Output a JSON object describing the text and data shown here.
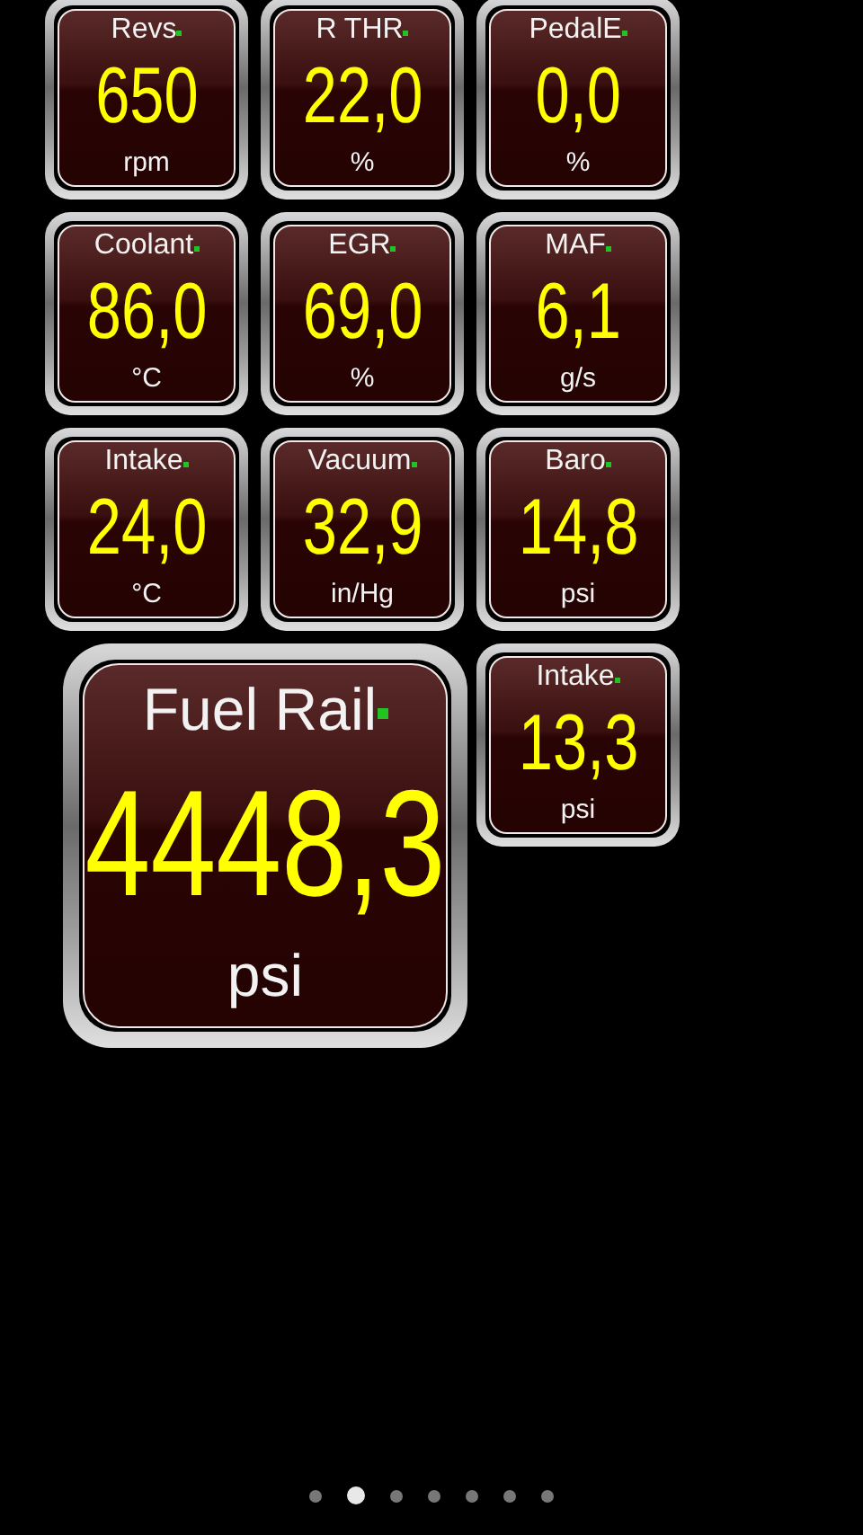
{
  "gauges": [
    {
      "label": "Revs",
      "value": "650",
      "unit": "rpm"
    },
    {
      "label": "R THR",
      "value": "22,0",
      "unit": "%"
    },
    {
      "label": "PedalE",
      "value": "0,0",
      "unit": "%"
    },
    {
      "label": "Coolant",
      "value": "86,0",
      "unit": "°C"
    },
    {
      "label": "EGR",
      "value": "69,0",
      "unit": "%"
    },
    {
      "label": "MAF",
      "value": "6,1",
      "unit": "g/s"
    },
    {
      "label": "Intake",
      "value": "24,0",
      "unit": "°C"
    },
    {
      "label": "Vacuum",
      "value": "32,9",
      "unit": "in/Hg"
    },
    {
      "label": "Baro",
      "value": "14,8",
      "unit": "psi"
    }
  ],
  "large_gauge": {
    "label": "Fuel Rail",
    "value": "4448,3",
    "unit": "psi"
  },
  "side_gauge": {
    "label": "Intake",
    "value": "13,3",
    "unit": "psi"
  },
  "pages": [
    {
      "selected": false
    },
    {
      "selected": true
    },
    {
      "selected": false
    },
    {
      "selected": false
    },
    {
      "selected": false
    },
    {
      "selected": false
    },
    {
      "selected": false
    }
  ]
}
